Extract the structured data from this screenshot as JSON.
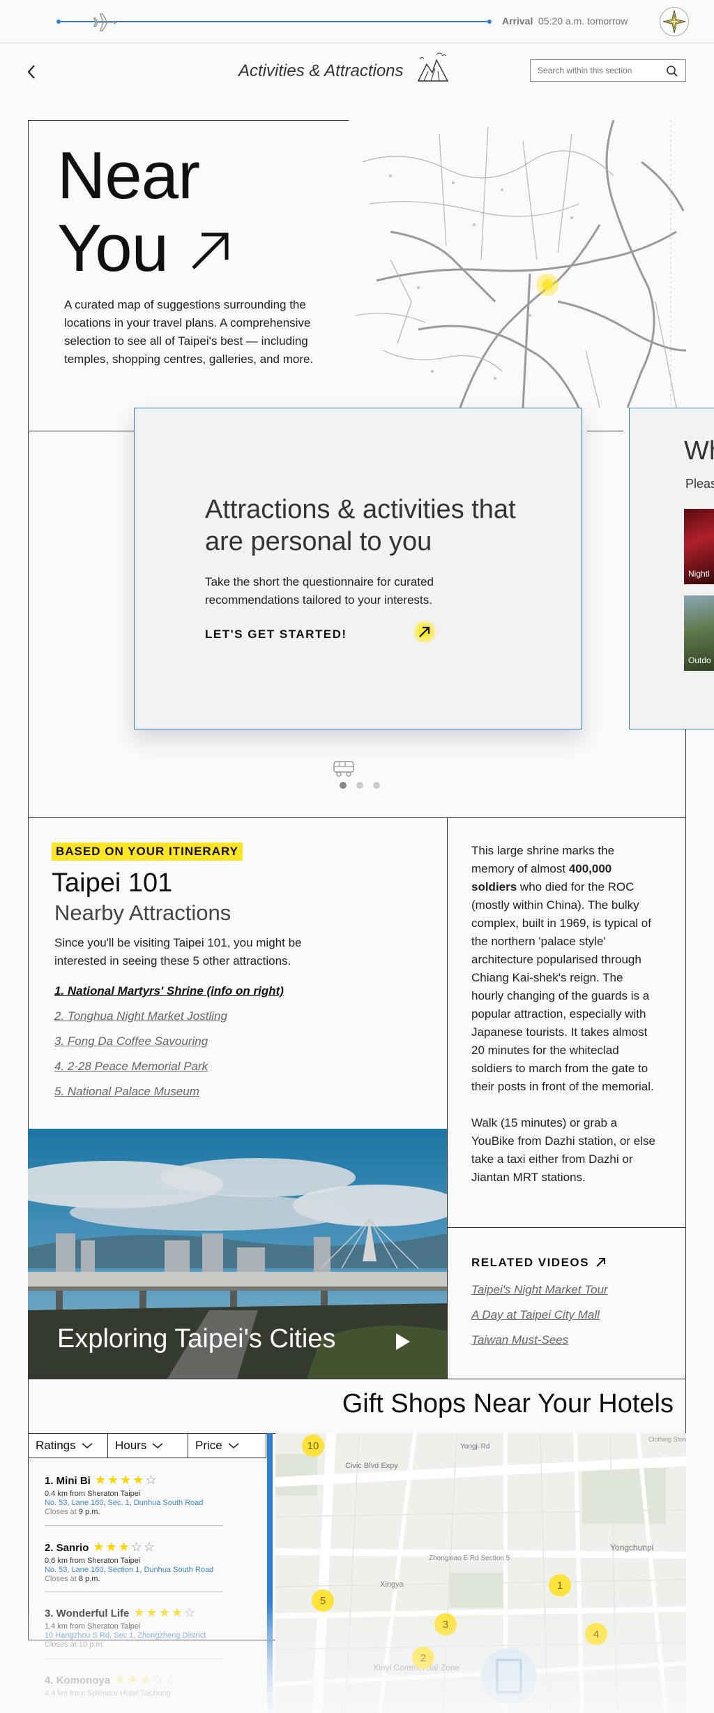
{
  "topbar": {
    "arrival_label": "Arrival",
    "arrival_time": "05:20 a.m. tomorrow"
  },
  "header": {
    "title": "Activities & Attractions",
    "search_placeholder": "Search within this section"
  },
  "near_you": {
    "title_line1": "Near",
    "title_line2": "You",
    "description": "A curated map of suggestions surrounding the locations in your travel plans. A comprehensive selection to see all of Taipei's best — including temples, shopping centres, galleries, and more."
  },
  "questionnaire_card": {
    "title": "Attractions & activities that are personal to you",
    "description": "Take the short the questionnaire for curated recommendations tailored to your interests.",
    "cta": "LET'S GET STARTED!"
  },
  "next_card": {
    "title": "Wh",
    "subtitle": "Pleas",
    "thumbs": [
      "Nightl",
      "Outdo"
    ]
  },
  "carousel": {
    "pages": 3,
    "active": 1
  },
  "itinerary": {
    "badge": "BASED ON YOUR ITINERARY",
    "place": "Taipei 101",
    "subtitle": "Nearby Attractions",
    "intro": "Since you'll be visiting Taipei 101, you might be interested in seeing these 5 other attractions.",
    "attractions": [
      "1. National Martyrs' Shrine (info on right)",
      "2. Tonghua Night Market Jostling",
      "3. Fong Da Coffee Savouring",
      "4. 2-28 Peace Memorial Park",
      "5. National Palace Museum"
    ]
  },
  "shrine": {
    "text_before": "This large shrine marks the memory of almost ",
    "text_bold": "400,000 soldiers",
    "text_after": " who died for the ROC (mostly within China). The bulky complex, built in 1969, is typical of the northern 'palace style' architecture popularised through Chiang Kai-shek's reign. The hourly changing of the guards is a popular attraction, especially with Japanese tourists. It takes almost 20 minutes for the whiteclad soldiers to march from the gate to their posts in front of the memorial.",
    "directions": "Walk (15 minutes) or grab a YouBike from Dazhi station, or else take a taxi either from Dazhi or Jiantan MRT stations."
  },
  "video": {
    "title": "Exploring Taipei's Cities"
  },
  "related": {
    "label": "RELATED VIDEOS",
    "videos": [
      "Taipei's Night Market Tour",
      "A Day at Taipei City Mall",
      "Taiwan Must-Sees"
    ]
  },
  "gift_shops": {
    "title": "Gift Shops Near Your Hotels",
    "filters": [
      "Ratings",
      "Hours",
      "Price"
    ],
    "shops": [
      {
        "name": "1. Mini Bi",
        "rating": 4,
        "distance": "0.4 km from Sheraton Taipei",
        "address": "No. 53, Lane 160, Sec. 1, Dunhua South Road",
        "hours_prefix": "Closes at ",
        "hours": "9 p.m."
      },
      {
        "name": "2. Sanrio",
        "rating": 3,
        "distance": "0.6 km from Sheraton Taipei",
        "address": "No. 53, Lane 160, Section 1, Dunhua South Road",
        "hours_prefix": "Closes at ",
        "hours": "8 p.m."
      },
      {
        "name": "3. Wonderful Life",
        "rating": 4,
        "distance": "1.4 km from Sheraton Taipei",
        "address": "10 Hangzhou S Rd, Sec 1, Zhongzheng District",
        "hours_prefix": "Closes at ",
        "hours": "10 p.m."
      },
      {
        "name": "4. Komonoya",
        "rating": 3,
        "distance": "4.4 km from Splendor Hotel Taichung",
        "address": "",
        "hours_prefix": "",
        "hours": ""
      }
    ],
    "map_labels": {
      "road1": "Civic Blvd Expy",
      "road2": "Yongji Rd",
      "road3": "Zhongxiao E Rd Section 5",
      "district1": "Yongchunpi",
      "district2": "Xingya",
      "district3": "Xinyi Commercial Zone",
      "corner": "Clothing Store",
      "pins": [
        "10",
        "1",
        "5",
        "3",
        "4",
        "2"
      ]
    }
  },
  "colors": {
    "accent": "#2f7fd6",
    "highlight": "#ffe524"
  }
}
